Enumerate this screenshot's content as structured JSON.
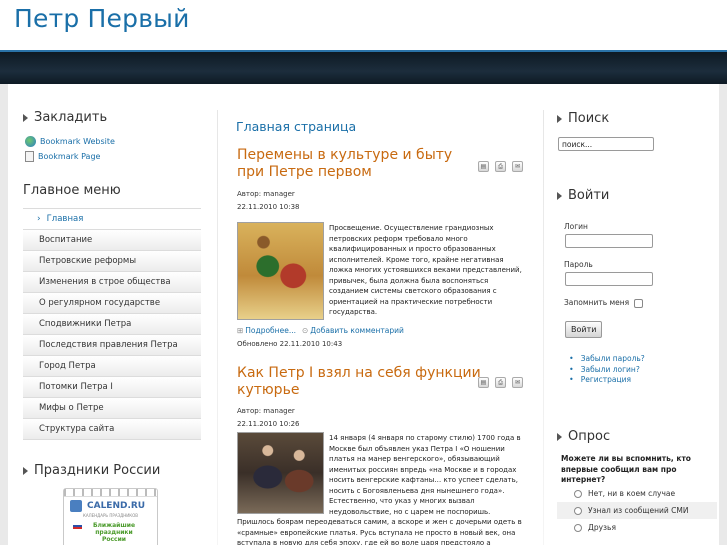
{
  "site": {
    "title": "Петр Первый"
  },
  "left": {
    "bookmark_title": "Закладить",
    "bookmarks": [
      {
        "label": "Bookmark Website",
        "icon": "globe-icon"
      },
      {
        "label": "Bookmark Page",
        "icon": "page-icon"
      }
    ],
    "menu_title": "Главное меню",
    "menu_items": [
      {
        "label": "Главная",
        "active": true
      },
      {
        "label": "Воспитание"
      },
      {
        "label": "Петровские реформы"
      },
      {
        "label": "Изменения в строе общества"
      },
      {
        "label": "О регулярном государстве"
      },
      {
        "label": "Сподвижники Петра"
      },
      {
        "label": "Последствия правления Петра"
      },
      {
        "label": "Город Петра"
      },
      {
        "label": "Потомки Петра I"
      },
      {
        "label": "Мифы о Петре"
      },
      {
        "label": "Структура сайта"
      }
    ],
    "holidays_title": "Праздники России",
    "calendar": {
      "name": "CALEND.RU",
      "subtitle": "КАЛЕНДАРЬ ПРАЗДНИКОВ",
      "text": "Ближайшие праздники России"
    }
  },
  "main": {
    "heading": "Главная страница",
    "articles": [
      {
        "title": "Перемены в культуре и быту при Петре первом",
        "author": "Автор: manager",
        "date": "22.11.2010 10:38",
        "body": "Просвещение. Осуществление грандиозных петровских реформ требовало много квалифицированных и просто образованных исполнителей. Кроме того, крайне негативная ложка многих устоявшихся веками представлений, привычек, была должна была воспоняться созданием системы светского образования с ориентацией на практические потребности государства.",
        "more_label": "Подробнее...",
        "comment_label": "Добавить комментарий",
        "updated": "Обновлено 22.11.2010 10:43"
      },
      {
        "title": "Как Петр I взял на себя функции кутюрье",
        "author": "Автор: manager",
        "date": "22.11.2010 10:26",
        "body": "14 января (4 января по старому стилю) 1700 года в Москве был объявлен указ Петра I «О ношении платья на манер венгерского», обязывающий именитых россиян впредь «на Москве и в городах носить венгерские кафтаны… кто успеет сделать, носить с Богоявленьева дня нынешнего года». Естественно, что указ у многих вызвал неудовольствие, но с царем не поспоришь.",
        "body_continued": "Пришлось боярам переодеваться самим, а вскоре и жен с дочерьми одеть в «срамные» европейские платья. Русь вступала не просто в новый век, она вступала в новую для себя эпоху, где ей во воле царя предстояло а"
      }
    ],
    "tools": [
      "pdf-icon",
      "print-icon",
      "email-icon"
    ]
  },
  "right": {
    "search_title": "Поиск",
    "search_value": "поиск...",
    "login_title": "Войти",
    "login_label": "Логин",
    "password_label": "Пароль",
    "remember_label": "Запомнить меня",
    "login_button": "Войти",
    "login_links": [
      "Забыли пароль?",
      "Забыли логин?",
      "Регистрация"
    ],
    "poll_title": "Опрос",
    "poll_question": "Можете ли вы вспомнить, кто впервые сообщил вам про интернет?",
    "poll_options": [
      "Нет, ни в коем случае",
      "Узнал из сообщений СМИ",
      "Друзья"
    ]
  }
}
